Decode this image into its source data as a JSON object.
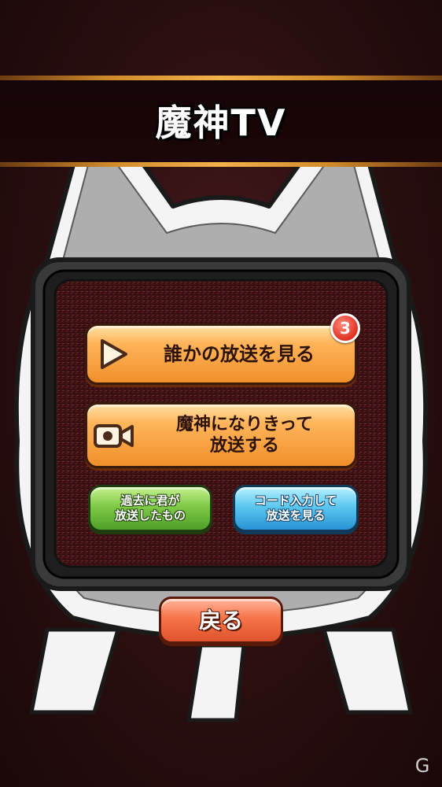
{
  "header": {
    "title": "魔神TV"
  },
  "buttons": {
    "watch": {
      "label": "誰かの放送を見る",
      "badge": "3"
    },
    "broadcast": {
      "line1": "魔神になりきって",
      "line2": "放送する"
    },
    "past": {
      "line1": "過去に君が",
      "line2": "放送したもの"
    },
    "code": {
      "line1": "コード入力して",
      "line2": "放送を見る"
    },
    "back": {
      "label": "戻る"
    }
  },
  "icons": {
    "watch": "play-icon",
    "broadcast": "video-camera-icon",
    "watermark": "site-logo-icon"
  },
  "colors": {
    "background": "#2a0e10",
    "accent_orange": "#f08f2a",
    "accent_green": "#4f9e28",
    "accent_blue": "#2a92d6",
    "accent_red": "#e0532c",
    "badge_red": "#e03020"
  },
  "watermark": "G"
}
